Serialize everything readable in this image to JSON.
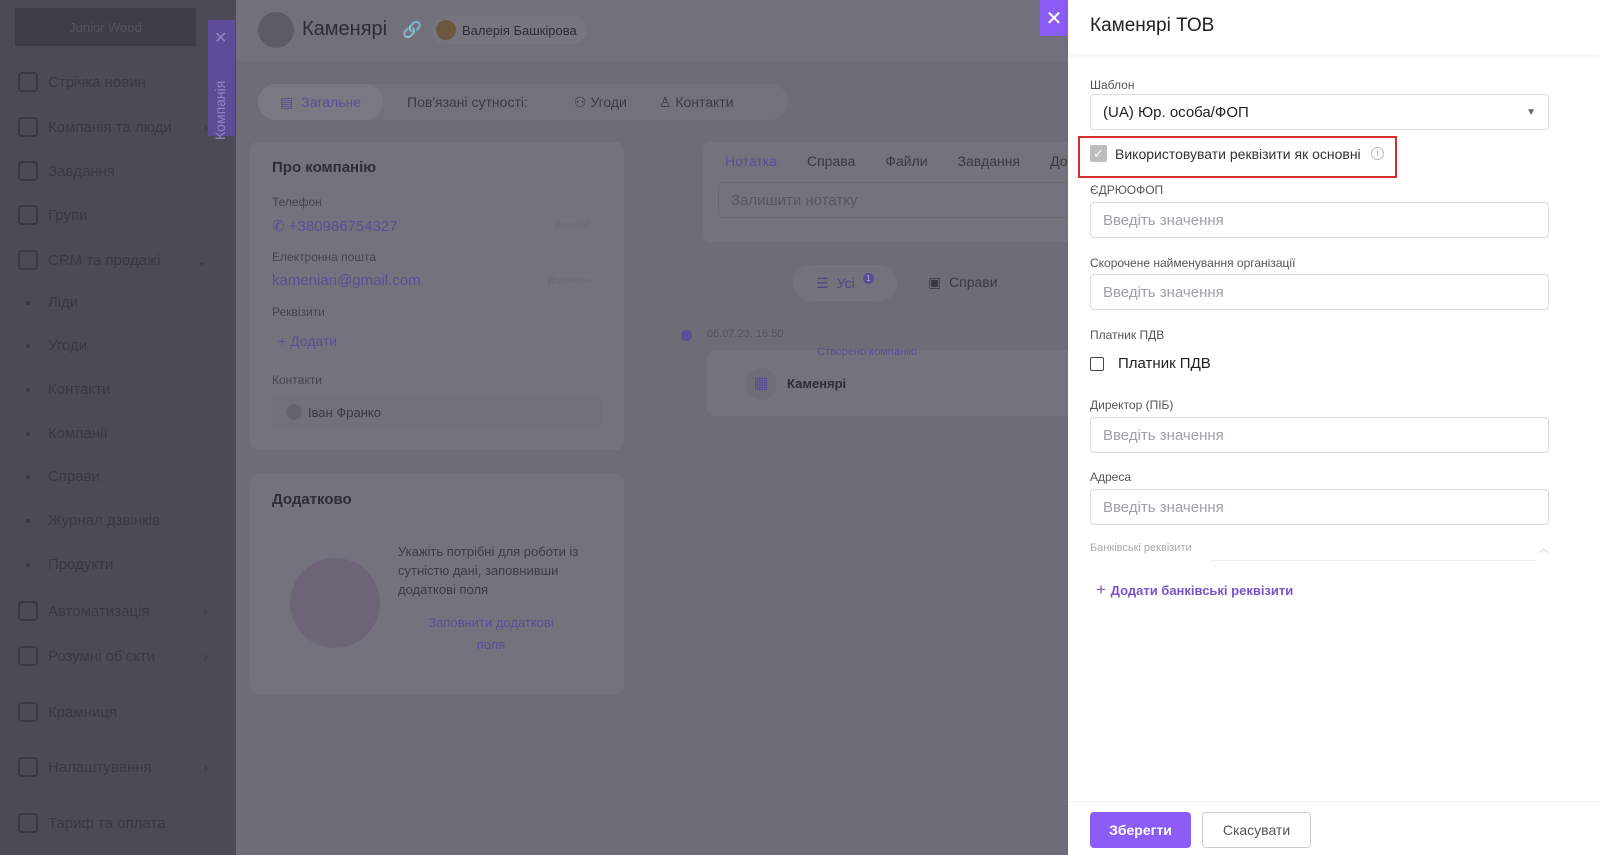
{
  "sidebar": {
    "logo": "Junior Wood",
    "items": [
      {
        "label": "Стрічка новин",
        "icon": "home-icon",
        "chevron": ""
      },
      {
        "label": "Компанія та люди",
        "icon": "building-icon",
        "chevron": "›"
      },
      {
        "label": "Завдання",
        "icon": "calendar-icon",
        "chevron": ""
      },
      {
        "label": "Групи",
        "icon": "users-icon",
        "chevron": ""
      },
      {
        "label": "CRM та продажі",
        "icon": "funnel-icon",
        "chevron": "⌄"
      },
      {
        "label": "Ліди",
        "sub": true
      },
      {
        "label": "Угоди",
        "sub": true
      },
      {
        "label": "Контакти",
        "sub": true
      },
      {
        "label": "Компанії",
        "sub": true
      },
      {
        "label": "Справи",
        "sub": true
      },
      {
        "label": "Журнал дзвінків",
        "sub": true
      },
      {
        "label": "Продукти",
        "sub": true
      },
      {
        "label": "Автоматизація",
        "icon": "lightning-icon",
        "chevron": "›"
      },
      {
        "label": "Розумні об'єкти",
        "icon": "smart-object-icon",
        "chevron": "›"
      },
      {
        "label": "Крамниця",
        "icon": "store-icon",
        "chevron": ""
      },
      {
        "label": "Налаштування",
        "icon": "gear-icon",
        "chevron": "›"
      },
      {
        "label": "Тариф та оплата",
        "icon": "bag-icon",
        "chevron": ""
      }
    ],
    "vertical_tab": "Компанія"
  },
  "header": {
    "title": "Каменярі",
    "user": "Валерія Башкірова"
  },
  "tabs": {
    "general": "Загальне",
    "related": "Пов'язані сутності:",
    "deals": "Угоди",
    "contacts": "Контакти"
  },
  "about": {
    "title": "Про компанію",
    "phone_label": "Телефон",
    "phone": "+380986754327",
    "phone_type": "Робочий",
    "email_label": "Електронна пошта",
    "email": "kameniari@gmail.com",
    "email_type": "Додаткова",
    "req_label": "Реквізити",
    "add": "Додати",
    "contacts_label": "Контакти",
    "contact": "Іван Франко"
  },
  "extra": {
    "title": "Додатково",
    "text": "Укажіть потрібні для роботи із сутністю дані, заповнивши додаткові поля",
    "link": "Заповнити додаткові поля"
  },
  "activity": {
    "tabs": [
      "Нотатка",
      "Справа",
      "Файли",
      "Завдання",
      "Док"
    ],
    "note_placeholder": "Залишити нотатку",
    "filter_all": "Усі",
    "filter_badge": "1",
    "filter_deals": "Справи",
    "date": "06.07.23, 16:50",
    "event": "Створено компанію",
    "entity": "Каменярі"
  },
  "panel": {
    "title": "Каменярі ТОВ",
    "template_label": "Шаблон",
    "template_value": "(UA) Юр. особа/ФОП",
    "use_main": "Використовувати реквізити як основні",
    "use_main_checked": true,
    "edrpou_label": "ЄДРЮОФОП",
    "placeholder": "Введіть значення",
    "short_name_label": "Скорочене найменування організації",
    "vat_label": "Платник ПДВ",
    "vat_checkbox": "Платник ПДВ",
    "vat_checked": false,
    "director_label": "Директор (ПІБ)",
    "address_label": "Адреса",
    "bank_label": "Банківські реквізити",
    "add_bank": "Додати банківські реквізити",
    "save": "Зберегти",
    "cancel": "Скасувати"
  },
  "colors": {
    "accent": "#8b5cf6",
    "highlight": "#d32f2f"
  }
}
